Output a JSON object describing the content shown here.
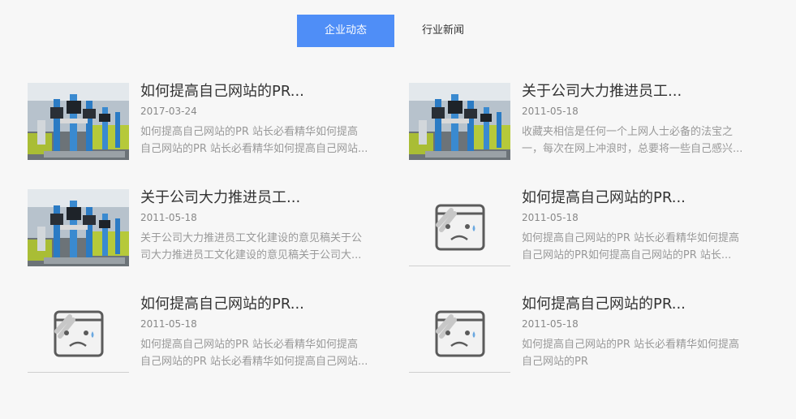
{
  "tabs": [
    {
      "label": "企业动态",
      "active": true
    },
    {
      "label": "行业新闻",
      "active": false
    }
  ],
  "news": [
    {
      "thumb": "photo",
      "title": "如何提高自己网站的PR...",
      "date": "2017-03-24",
      "desc_line1": "如何提高自己网站的PR 站长必看精华如何提高",
      "desc_line2": "自己网站的PR 站长必看精华如何提高自己网站..."
    },
    {
      "thumb": "photo",
      "title": "关于公司大力推进员工...",
      "date": "2011-05-18",
      "desc_line1": "收藏夹相信是任何一个上网人士必备的法宝之",
      "desc_line2": "一，每次在网上冲浪时，总要将一些自己感兴..."
    },
    {
      "thumb": "photo",
      "title": "关于公司大力推进员工...",
      "date": "2011-05-18",
      "desc_line1": "关于公司大力推进员工文化建设的意见稿关于公",
      "desc_line2": "司大力推进员工文化建设的意见稿关于公司大..."
    },
    {
      "thumb": "broken",
      "title": "如何提高自己网站的PR...",
      "date": "2011-05-18",
      "desc_line1": "如何提高自己网站的PR 站长必看精华如何提高",
      "desc_line2": "自己网站的PR如何提高自己网站的PR 站长..."
    },
    {
      "thumb": "broken",
      "title": "如何提高自己网站的PR...",
      "date": "2011-05-18",
      "desc_line1": "如何提高自己网站的PR 站长必看精华如何提高",
      "desc_line2": "自己网站的PR 站长必看精华如何提高自己网站..."
    },
    {
      "thumb": "broken",
      "title": "如何提高自己网站的PR...",
      "date": "2011-05-18",
      "desc_line1": "如何提高自己网站的PR 站长必看精华如何提高",
      "desc_line2": "自己网站的PR"
    }
  ],
  "colors": {
    "accent": "#4f8ef7",
    "title": "#333333",
    "meta": "#888888",
    "desc": "#999999"
  }
}
